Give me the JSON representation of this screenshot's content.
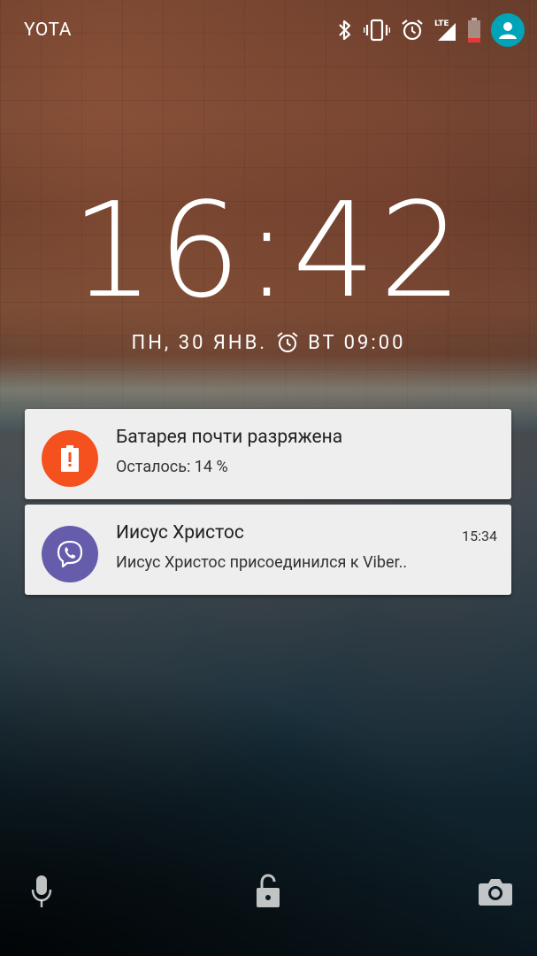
{
  "status_bar": {
    "carrier": "YOTA",
    "network": "LTE",
    "icons": [
      "bluetooth-icon",
      "vibrate-icon",
      "alarm-icon",
      "lte-signal-icon",
      "battery-low-icon",
      "user-avatar-icon"
    ],
    "accent_avatar": "#00a4b8"
  },
  "lockscreen": {
    "time": "16:42",
    "date": "ПН, 30 ЯНВ.",
    "alarm": "ВТ 09:00"
  },
  "notifications": [
    {
      "app_icon": "battery-alert-icon",
      "icon_color": "#f4511e",
      "title": "Батарея почти разряжена",
      "text": "Осталось: 14 %",
      "time": ""
    },
    {
      "app_icon": "viber-icon",
      "icon_color": "#665cac",
      "title": "Иисус Христос",
      "text": "Иисус Христос присоединился к Viber..",
      "time": "15:34"
    }
  ],
  "bottom_bar": {
    "left": "microphone-icon",
    "center": "lock-icon",
    "right": "camera-icon"
  }
}
